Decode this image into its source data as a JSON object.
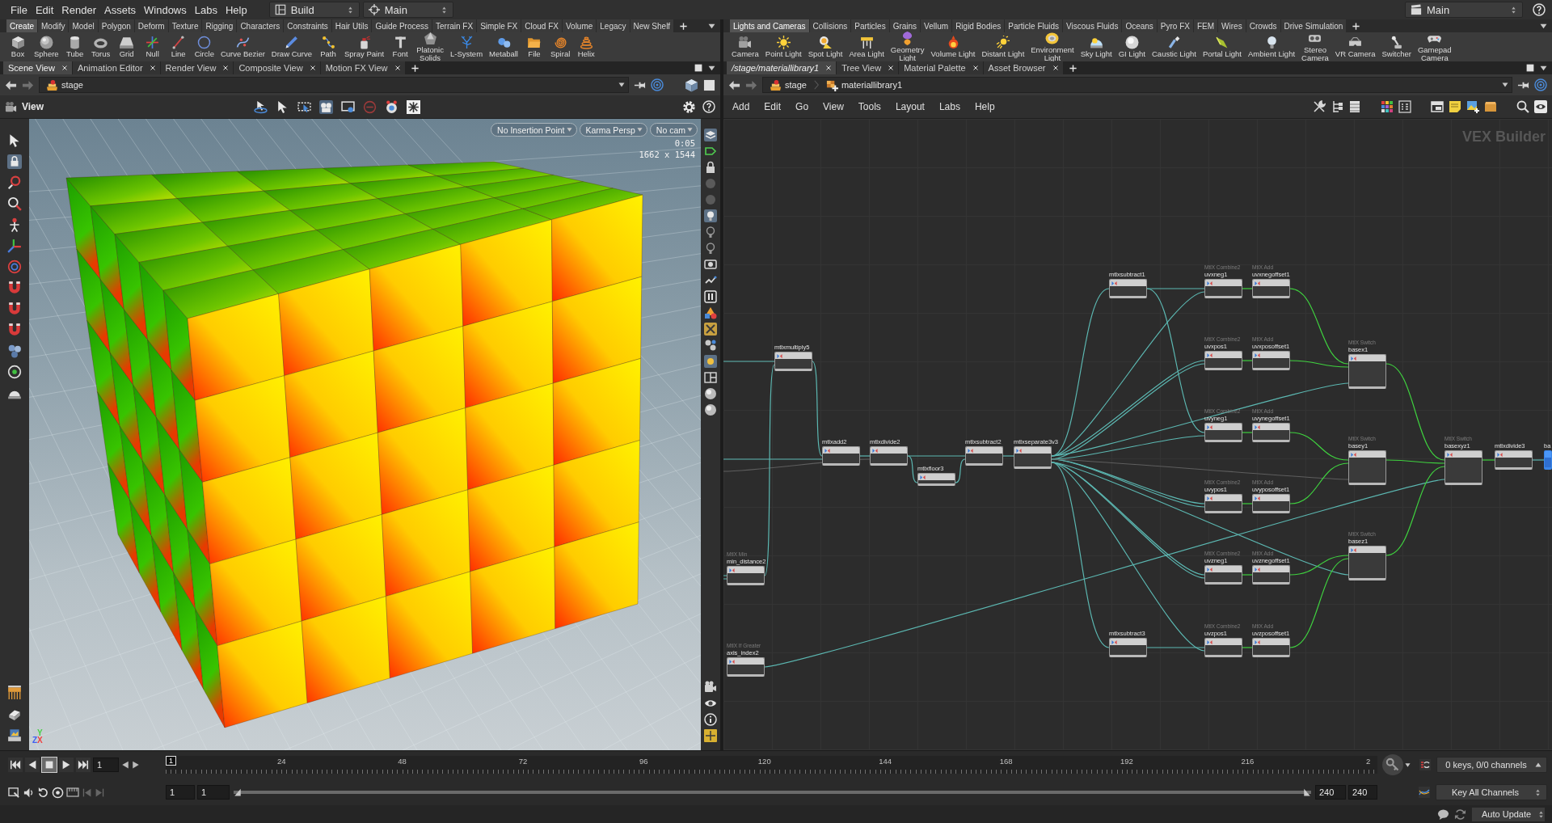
{
  "menu_bar": {
    "menus": [
      "File",
      "Edit",
      "Render",
      "Assets",
      "Windows",
      "Labs",
      "Help"
    ],
    "desktop": "Build",
    "context": "Main",
    "scene": "Main"
  },
  "left_shelf": {
    "tabs": [
      {
        "label": "Create",
        "selected": true
      },
      {
        "label": "Modify",
        "selected": false
      },
      {
        "label": "Model",
        "selected": false
      },
      {
        "label": "Polygon",
        "selected": false
      },
      {
        "label": "Deform",
        "selected": false
      },
      {
        "label": "Texture",
        "selected": false
      },
      {
        "label": "Rigging",
        "selected": false
      },
      {
        "label": "Characters",
        "selected": false
      },
      {
        "label": "Constraints",
        "selected": false
      },
      {
        "label": "Hair Utils",
        "selected": false
      },
      {
        "label": "Guide Process",
        "selected": false
      },
      {
        "label": "Terrain FX",
        "selected": false
      },
      {
        "label": "Simple FX",
        "selected": false
      },
      {
        "label": "Cloud FX",
        "selected": false
      },
      {
        "label": "Volume",
        "selected": false
      },
      {
        "label": "Legacy",
        "selected": false
      },
      {
        "label": "New Shelf",
        "selected": false
      }
    ],
    "tools": [
      "Box",
      "Sphere",
      "Tube",
      "Torus",
      "Grid",
      "Null",
      "Line",
      "Circle",
      "Curve Bezier",
      "Draw Curve",
      "Path",
      "Spray Paint",
      "Font",
      "Platonic\nSolids",
      "L-System",
      "Metaball",
      "File",
      "Spiral",
      "Helix"
    ]
  },
  "right_shelf": {
    "tabs": [
      {
        "label": "Lights and Cameras",
        "selected": true
      },
      {
        "label": "Collisions",
        "selected": false
      },
      {
        "label": "Particles",
        "selected": false
      },
      {
        "label": "Grains",
        "selected": false
      },
      {
        "label": "Vellum",
        "selected": false
      },
      {
        "label": "Rigid Bodies",
        "selected": false
      },
      {
        "label": "Particle Fluids",
        "selected": false
      },
      {
        "label": "Viscous Fluids",
        "selected": false
      },
      {
        "label": "Oceans",
        "selected": false
      },
      {
        "label": "Pyro FX",
        "selected": false
      },
      {
        "label": "FEM",
        "selected": false
      },
      {
        "label": "Wires",
        "selected": false
      },
      {
        "label": "Crowds",
        "selected": false
      },
      {
        "label": "Drive Simulation",
        "selected": false
      }
    ],
    "tools": [
      "Camera",
      "Point Light",
      "Spot Light",
      "Area Light",
      "Geometry\nLight",
      "Volume Light",
      "Distant Light",
      "Environment\nLight",
      "Sky Light",
      "GI Light",
      "Caustic Light",
      "Portal Light",
      "Ambient Light",
      "Stereo\nCamera",
      "VR Camera",
      "Switcher",
      "Gamepad\nCamera"
    ]
  },
  "scene_pane": {
    "tabs": [
      {
        "label": "Scene View",
        "selected": true
      },
      {
        "label": "Animation Editor",
        "selected": false
      },
      {
        "label": "Render View",
        "selected": false
      },
      {
        "label": "Composite View",
        "selected": false
      },
      {
        "label": "Motion FX View",
        "selected": false
      }
    ],
    "path": "stage",
    "viewer_title": "View",
    "overlay_menus": [
      "No Insertion Point",
      "Karma Persp",
      "No cam"
    ],
    "time": "0:05",
    "resolution": "1662 x 1544",
    "axis_gizmo": [
      {
        "label": "Y",
        "color": "#46d046"
      },
      {
        "label": "Z",
        "color": "#4060f0"
      },
      {
        "label": "X",
        "color": "#f04040"
      }
    ]
  },
  "network_pane": {
    "tabs": [
      {
        "label": "/stage/materiallibrary1",
        "kind": "network",
        "selected": true
      },
      {
        "label": "Tree View",
        "kind": "panel",
        "selected": false
      },
      {
        "label": "Material Palette",
        "kind": "panel",
        "selected": false
      },
      {
        "label": "Asset Browser",
        "kind": "panel",
        "selected": false
      }
    ],
    "path": [
      "stage",
      "materiallibrary1"
    ],
    "menus": [
      "Add",
      "Edit",
      "Go",
      "View",
      "Tools",
      "Layout",
      "Labs",
      "Help"
    ],
    "context_label": "VEX Builder",
    "nodes": [
      {
        "name": "mtlxmultiply5",
        "kind": "binary",
        "selected": false
      },
      {
        "name": "mtlxadd2",
        "kind": "binary",
        "selected": false
      },
      {
        "name": "mtlxdivide2",
        "kind": "binary",
        "selected": false
      },
      {
        "name": "mtlxfloor3",
        "kind": "unary",
        "selected": false
      },
      {
        "name": "mtlxsubtract2",
        "kind": "binary",
        "selected": false
      },
      {
        "name": "mtlxseparate3v3",
        "kind": "separate",
        "selected": false
      },
      {
        "name": "mtlxsubtract1",
        "kind": "binary",
        "selected": false
      },
      {
        "type": "MtlX Combine2",
        "name": "uvxneg1",
        "kind": "binary",
        "selected": false
      },
      {
        "type": "MtlX Add",
        "name": "uvxnegoffset1",
        "kind": "binary",
        "selected": false
      },
      {
        "type": "MtlX Combine2",
        "name": "uvxpos1",
        "kind": "binary",
        "selected": false
      },
      {
        "type": "MtlX Add",
        "name": "uvxposoffset1",
        "kind": "binary",
        "selected": false
      },
      {
        "type": "MtlX Switch",
        "name": "basex1",
        "kind": "switch",
        "selected": false
      },
      {
        "type": "MtlX Combine2",
        "name": "uvyneg1",
        "kind": "binary",
        "selected": false
      },
      {
        "type": "MtlX Add",
        "name": "uvynegoffset1",
        "kind": "binary",
        "selected": false
      },
      {
        "type": "MtlX Switch",
        "name": "basey1",
        "kind": "switch",
        "selected": false
      },
      {
        "type": "MtlX Switch",
        "name": "basexyz1",
        "kind": "switch",
        "selected": false
      },
      {
        "name": "mtlxdivide3",
        "kind": "binary",
        "selected": false
      },
      {
        "name": "ba",
        "kind": "binary",
        "selected": true
      },
      {
        "type": "MtlX Combine2",
        "name": "uvypos1",
        "kind": "binary",
        "selected": false
      },
      {
        "type": "MtlX Add",
        "name": "uvyposoffset1",
        "kind": "binary",
        "selected": false
      },
      {
        "type": "MtlX Switch",
        "name": "basez1",
        "kind": "switch",
        "selected": false
      },
      {
        "type": "MtlX Combine2",
        "name": "uvzneg1",
        "kind": "binary",
        "selected": false
      },
      {
        "type": "MtlX Add",
        "name": "uvznegoffset1",
        "kind": "binary",
        "selected": false
      },
      {
        "name": "mtlxsubtract3",
        "kind": "binary",
        "selected": false
      },
      {
        "type": "MtlX Combine2",
        "name": "uvzpos1",
        "kind": "binary",
        "selected": false
      },
      {
        "type": "MtlX Add",
        "name": "uvzposoffset1",
        "kind": "binary",
        "selected": false
      },
      {
        "type": "MtlX Min",
        "name": "min_distance2",
        "kind": "binary",
        "selected": false
      },
      {
        "type": "MtlX If Greater",
        "name": "axis_index2",
        "kind": "binary",
        "selected": false
      }
    ]
  },
  "timeline": {
    "playing": false,
    "frame": "1",
    "playhead": {
      "label": "1",
      "level": 0
    },
    "ruler_labels": [
      "24",
      "48",
      "72",
      "96",
      "120",
      "144",
      "168",
      "192",
      "216",
      "2"
    ],
    "range_start": "1",
    "range_current": "1",
    "range_end": "240",
    "frame_end": "240",
    "keys": "0 keys, 0/0 channels",
    "key_mode": "Key All Channels"
  },
  "status_bar": {
    "update_mode": "Auto Update"
  }
}
